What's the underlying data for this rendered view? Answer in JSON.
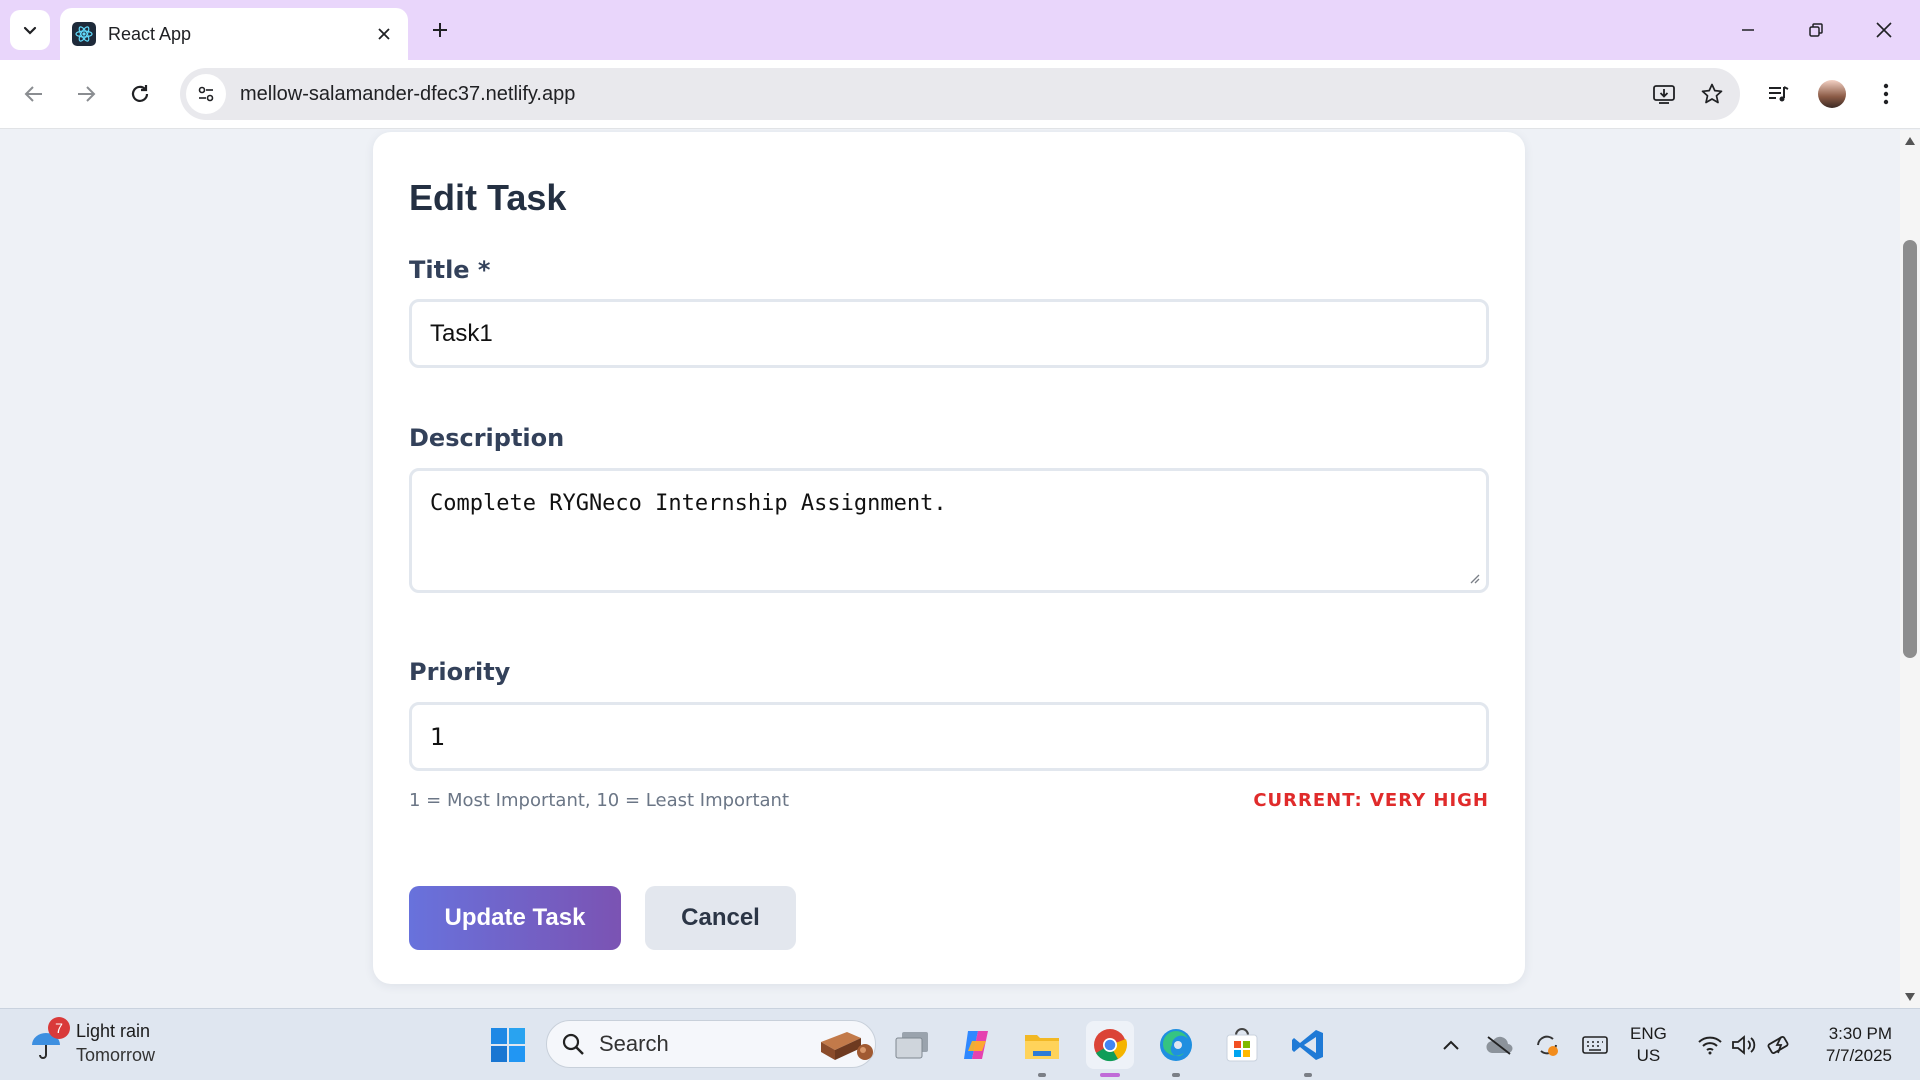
{
  "browser": {
    "tab_title": "React App",
    "url": "mellow-salamander-dfec37.netlify.app"
  },
  "form": {
    "heading": "Edit Task",
    "title_label": "Title *",
    "title_value": "Task1",
    "description_label": "Description",
    "description_value": "Complete RYGNeco Internship Assignment.",
    "priority_label": "Priority",
    "priority_value": "1",
    "priority_hint": "1 = Most Important, 10 = Least Important",
    "priority_current": "CURRENT: VERY HIGH",
    "submit_label": "Update Task",
    "cancel_label": "Cancel"
  },
  "taskbar": {
    "weather_badge": "7",
    "weather_line1": "Light rain",
    "weather_line2": "Tomorrow",
    "search_label": "Search",
    "lang_line1": "ENG",
    "lang_line2": "US",
    "time": "3:30 PM",
    "date": "7/7/2025"
  },
  "colors": {
    "accent_gradient_start": "#6872dc",
    "accent_gradient_end": "#7b53b3",
    "priority_current": "#e02b2b",
    "titlebar": "#e9d6fb"
  }
}
